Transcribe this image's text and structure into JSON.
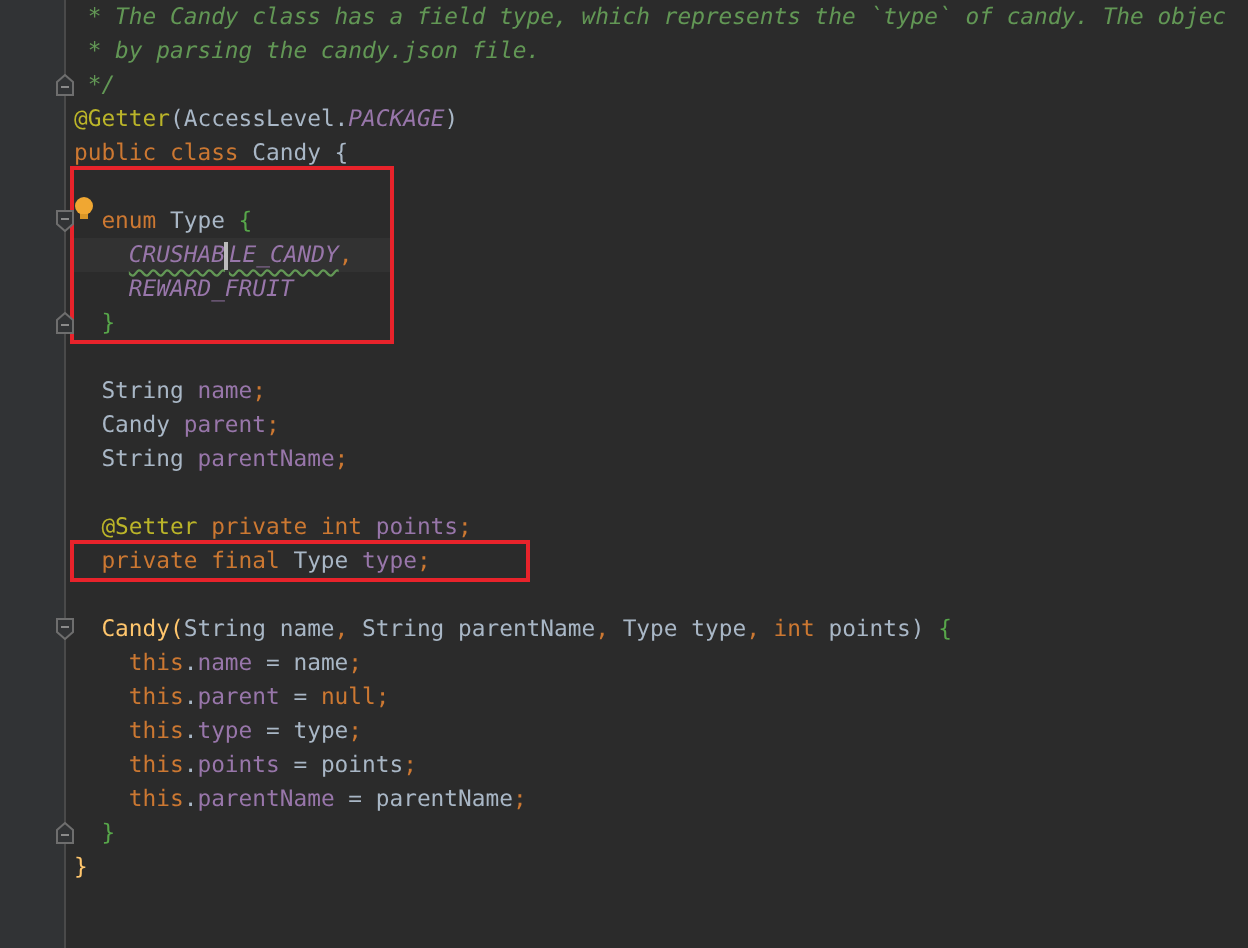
{
  "editor": {
    "blocks": [
      {
        "highlighted": false,
        "lines": [
          {
            "tokens": [
              {
                "kind": "comment",
                "text": " * The Candy class has a field type, which represents the `type` of candy. The objec"
              }
            ]
          },
          {
            "tokens": [
              {
                "kind": "comment",
                "text": " * by parsing the candy.json file."
              }
            ]
          },
          {
            "fold_end": true,
            "tokens": [
              {
                "kind": "comment",
                "text": " */"
              }
            ]
          },
          {
            "tokens": [
              {
                "kind": "annotation",
                "text": "@Getter"
              },
              {
                "kind": "plain",
                "text": "(AccessLevel."
              },
              {
                "kind": "constant",
                "text": "PACKAGE"
              },
              {
                "kind": "plain",
                "text": ")"
              }
            ]
          },
          {
            "tokens": [
              {
                "kind": "keyword",
                "text": "public class "
              },
              {
                "kind": "plain",
                "text": "Candy {"
              }
            ]
          }
        ]
      },
      {
        "highlighted": true,
        "lines": [
          {
            "space_above": true,
            "fold_start": true,
            "bulb": true,
            "tokens": [
              {
                "kind": "keyword",
                "text": "  enum "
              },
              {
                "kind": "plain",
                "text": "Type "
              },
              {
                "kind": "brace",
                "text": "{"
              }
            ]
          },
          {
            "current": true,
            "tokens": [
              {
                "kind": "constant",
                "text": "    CRUSHAB",
                "warning": true,
                "caret": true
              },
              {
                "kind": "constant",
                "text": "LE_CANDY",
                "warning": true
              },
              {
                "kind": "keyword",
                "text": ","
              }
            ]
          },
          {
            "tokens": [
              {
                "kind": "constant",
                "text": "    REWARD_FRUIT"
              }
            ]
          },
          {
            "fold_end": true,
            "tokens": [
              {
                "kind": "brace",
                "text": "  }"
              }
            ]
          }
        ]
      },
      {
        "highlighted": false,
        "lines": [
          {
            "space_above": true,
            "tokens": [
              {
                "kind": "plain",
                "text": "  String "
              },
              {
                "kind": "field",
                "text": "name"
              },
              {
                "kind": "keyword",
                "text": ";"
              }
            ]
          },
          {
            "tokens": [
              {
                "kind": "plain",
                "text": "  Candy "
              },
              {
                "kind": "field",
                "text": "parent"
              },
              {
                "kind": "keyword",
                "text": ";"
              }
            ]
          },
          {
            "tokens": [
              {
                "kind": "plain",
                "text": "  String "
              },
              {
                "kind": "field",
                "text": "parentName"
              },
              {
                "kind": "keyword",
                "text": ";"
              }
            ]
          },
          {
            "space_above": true,
            "tokens": [
              {
                "kind": "annotation",
                "text": "  @Setter "
              },
              {
                "kind": "keyword",
                "text": "private int "
              },
              {
                "kind": "field",
                "text": "points"
              },
              {
                "kind": "keyword",
                "text": ";"
              }
            ]
          }
        ]
      },
      {
        "highlighted": true,
        "lines": [
          {
            "tokens": [
              {
                "kind": "keyword",
                "text": "  private final "
              },
              {
                "kind": "plain",
                "text": "Type "
              },
              {
                "kind": "field",
                "text": "type"
              },
              {
                "kind": "keyword",
                "text": ";"
              }
            ]
          }
        ]
      },
      {
        "highlighted": false,
        "lines": [
          {
            "space_above": true,
            "fold_start": true,
            "tokens": [
              {
                "kind": "method",
                "text": "  Candy("
              },
              {
                "kind": "plain",
                "text": "String name"
              },
              {
                "kind": "keyword",
                "text": ", "
              },
              {
                "kind": "plain",
                "text": "String parentName"
              },
              {
                "kind": "keyword",
                "text": ", "
              },
              {
                "kind": "plain",
                "text": "Type type"
              },
              {
                "kind": "keyword",
                "text": ", int "
              },
              {
                "kind": "plain",
                "text": "points) "
              },
              {
                "kind": "brace",
                "text": "{"
              }
            ]
          },
          {
            "tokens": [
              {
                "kind": "keyword",
                "text": "    this"
              },
              {
                "kind": "plain",
                "text": "."
              },
              {
                "kind": "field",
                "text": "name"
              },
              {
                "kind": "plain",
                "text": " = name"
              },
              {
                "kind": "keyword",
                "text": ";"
              }
            ]
          },
          {
            "tokens": [
              {
                "kind": "keyword",
                "text": "    this"
              },
              {
                "kind": "plain",
                "text": "."
              },
              {
                "kind": "field",
                "text": "parent"
              },
              {
                "kind": "plain",
                "text": " = "
              },
              {
                "kind": "keyword",
                "text": "null;"
              }
            ]
          },
          {
            "tokens": [
              {
                "kind": "keyword",
                "text": "    this"
              },
              {
                "kind": "plain",
                "text": "."
              },
              {
                "kind": "field",
                "text": "type"
              },
              {
                "kind": "plain",
                "text": " = type"
              },
              {
                "kind": "keyword",
                "text": ";"
              }
            ]
          },
          {
            "tokens": [
              {
                "kind": "keyword",
                "text": "    this"
              },
              {
                "kind": "plain",
                "text": "."
              },
              {
                "kind": "field",
                "text": "points"
              },
              {
                "kind": "plain",
                "text": " = points"
              },
              {
                "kind": "keyword",
                "text": ";"
              }
            ]
          },
          {
            "tokens": [
              {
                "kind": "keyword",
                "text": "    this"
              },
              {
                "kind": "plain",
                "text": "."
              },
              {
                "kind": "field",
                "text": "parentName"
              },
              {
                "kind": "plain",
                "text": " = parentName"
              },
              {
                "kind": "keyword",
                "text": ";"
              }
            ]
          },
          {
            "fold_end": true,
            "tokens": [
              {
                "kind": "brace",
                "text": "  }"
              }
            ]
          },
          {
            "tokens": [
              {
                "kind": "method",
                "text": "}"
              }
            ]
          }
        ]
      }
    ]
  }
}
